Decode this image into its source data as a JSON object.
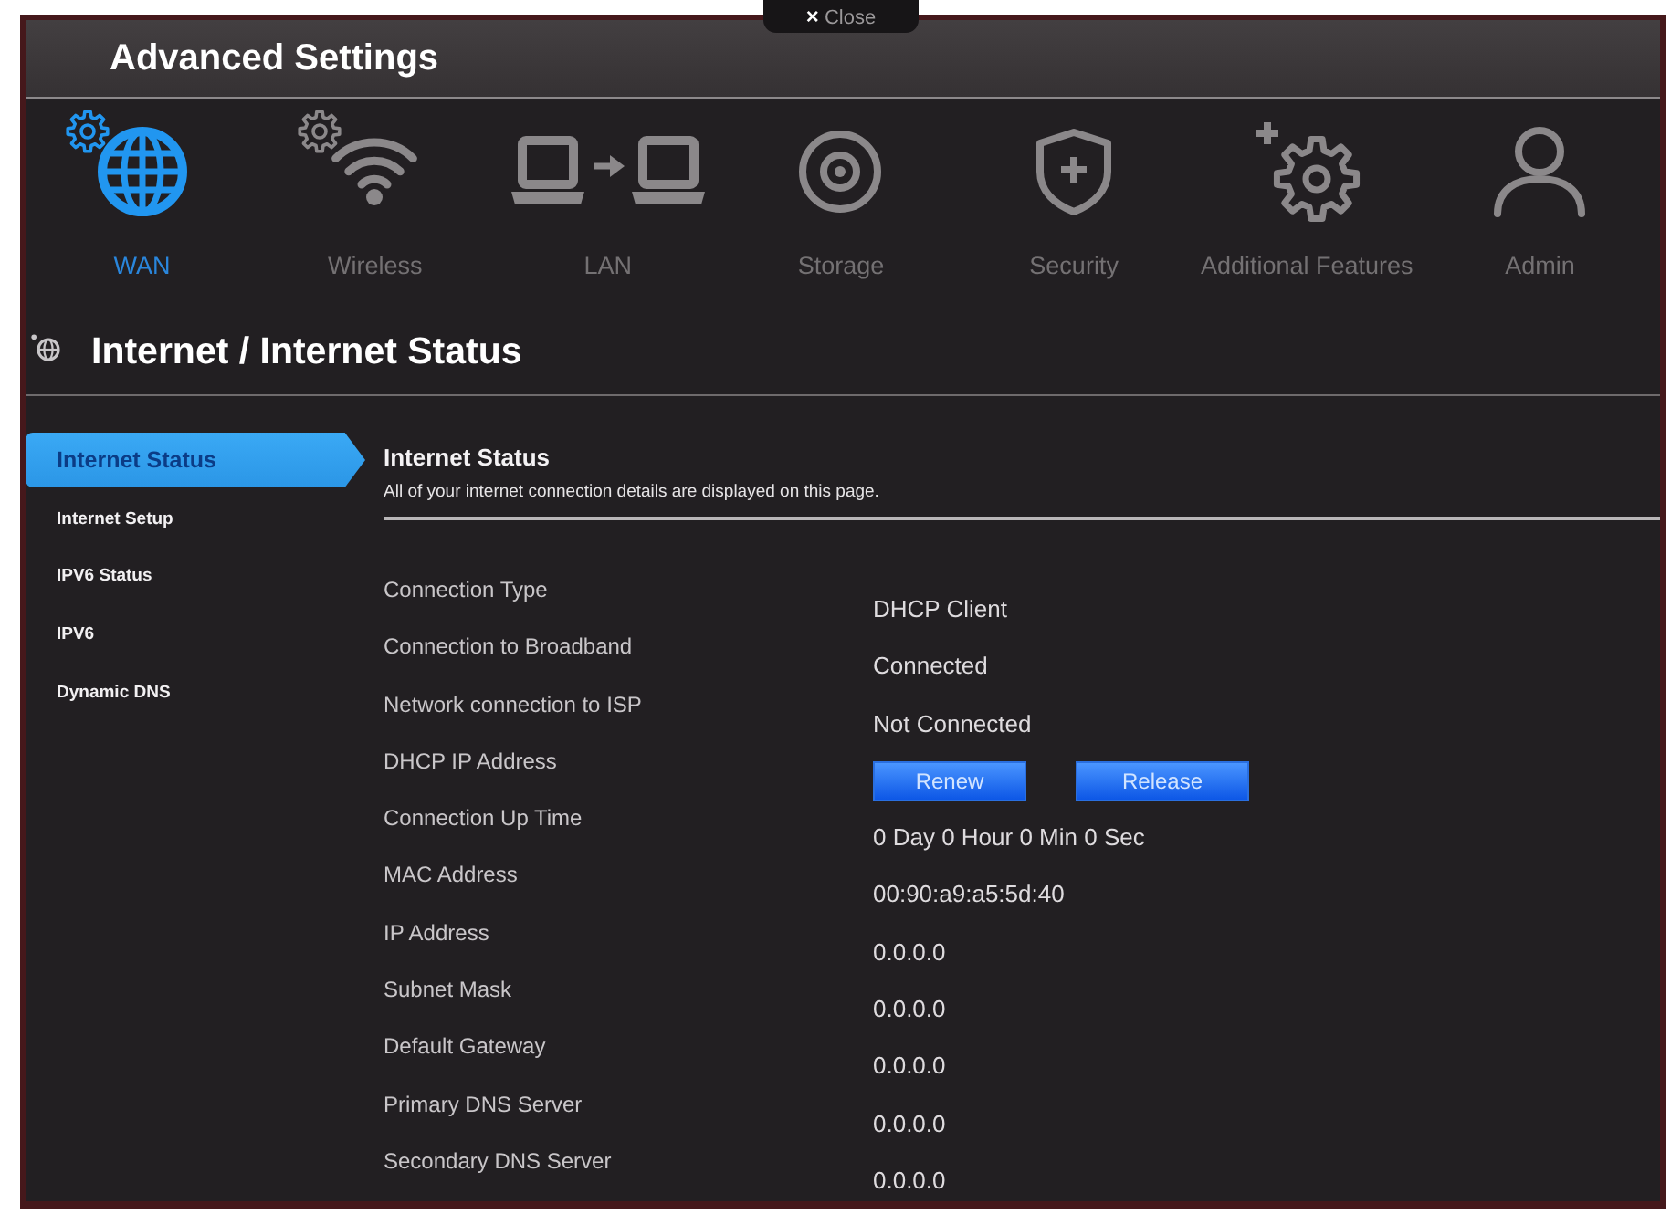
{
  "window": {
    "title": "Advanced Settings"
  },
  "close_tab": {
    "icon": "×",
    "label": "Close"
  },
  "nav": [
    {
      "label": "WAN",
      "selected": true
    },
    {
      "label": "Wireless",
      "selected": false
    },
    {
      "label": "LAN",
      "selected": false
    },
    {
      "label": "Storage",
      "selected": false
    },
    {
      "label": "Security",
      "selected": false
    },
    {
      "label": "Additional Features",
      "selected": false
    },
    {
      "label": "Admin",
      "selected": false
    }
  ],
  "breadcrumb": "Internet / Internet Status",
  "sidebar": {
    "items": [
      {
        "label": "Internet Status",
        "selected": true
      },
      {
        "label": "Internet Setup",
        "selected": false
      },
      {
        "label": "IPV6 Status",
        "selected": false
      },
      {
        "label": "IPV6",
        "selected": false
      },
      {
        "label": "Dynamic DNS",
        "selected": false
      }
    ]
  },
  "panel": {
    "title": "Internet Status",
    "description": "All of your internet connection details are displayed on this page.",
    "fields": [
      {
        "label": "Connection Type",
        "kind": "text",
        "value": "DHCP Client"
      },
      {
        "label": "Connection to Broadband",
        "kind": "text",
        "value": "Connected"
      },
      {
        "label": "Network connection to ISP",
        "kind": "text",
        "value": "Not Connected"
      },
      {
        "label": "DHCP IP Address",
        "kind": "buttons",
        "buttons": [
          "Renew",
          "Release"
        ]
      },
      {
        "label": "Connection Up Time",
        "kind": "text",
        "value": "0 Day 0 Hour 0 Min 0 Sec"
      },
      {
        "label": "MAC Address",
        "kind": "text",
        "value": "00:90:a9:a5:5d:40"
      },
      {
        "label": "IP Address",
        "kind": "text",
        "value": "0.0.0.0"
      },
      {
        "label": "Subnet Mask",
        "kind": "text",
        "value": "0.0.0.0"
      },
      {
        "label": "Default Gateway",
        "kind": "text",
        "value": "0.0.0.0"
      },
      {
        "label": "Primary DNS Server",
        "kind": "text",
        "value": "0.0.0.0"
      },
      {
        "label": "Secondary DNS Server",
        "kind": "text",
        "value": "0.0.0.0"
      }
    ]
  }
}
